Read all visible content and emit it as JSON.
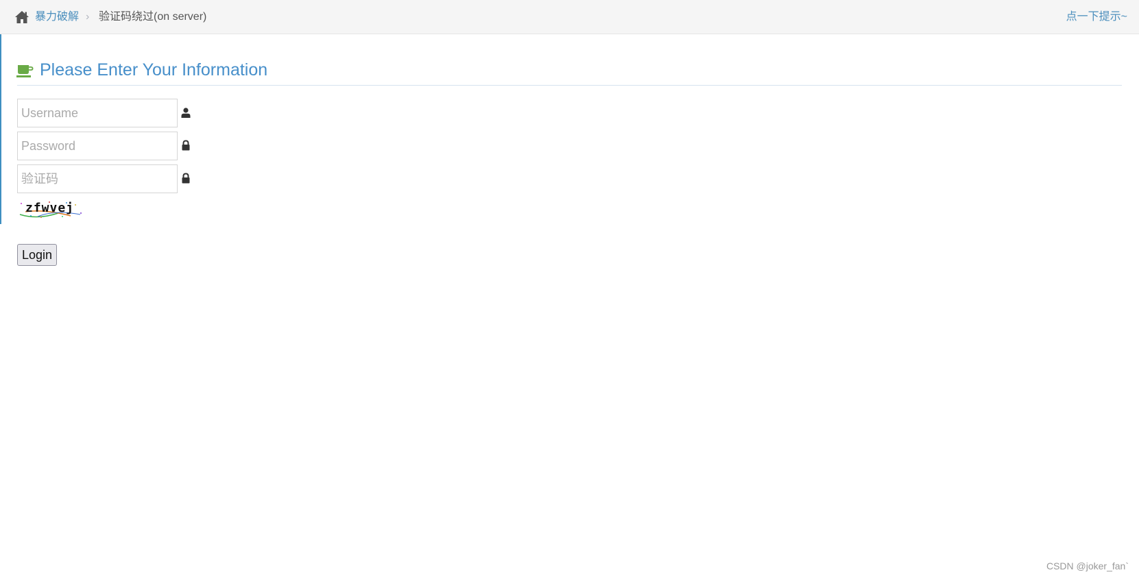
{
  "breadcrumb": {
    "parent_label": "暴力破解",
    "separator": "›",
    "current_label": "验证码绕过(on server)"
  },
  "hint_link": "点一下提示~",
  "form": {
    "title": "Please Enter Your Information",
    "username_placeholder": "Username",
    "password_placeholder": "Password",
    "captcha_placeholder": "验证码",
    "captcha_image_text": "zfwvej",
    "login_label": "Login"
  },
  "watermark": "CSDN @joker_fan`",
  "colors": {
    "link": "#4c8fbd",
    "title": "#478fca",
    "cup_icon": "#69aa46",
    "topbar_bg": "#f5f5f5"
  },
  "icons": {
    "home": "home-icon",
    "title": "coffee-cup-icon",
    "username": "user-icon",
    "password": "lock-icon",
    "captcha": "lock-icon"
  }
}
